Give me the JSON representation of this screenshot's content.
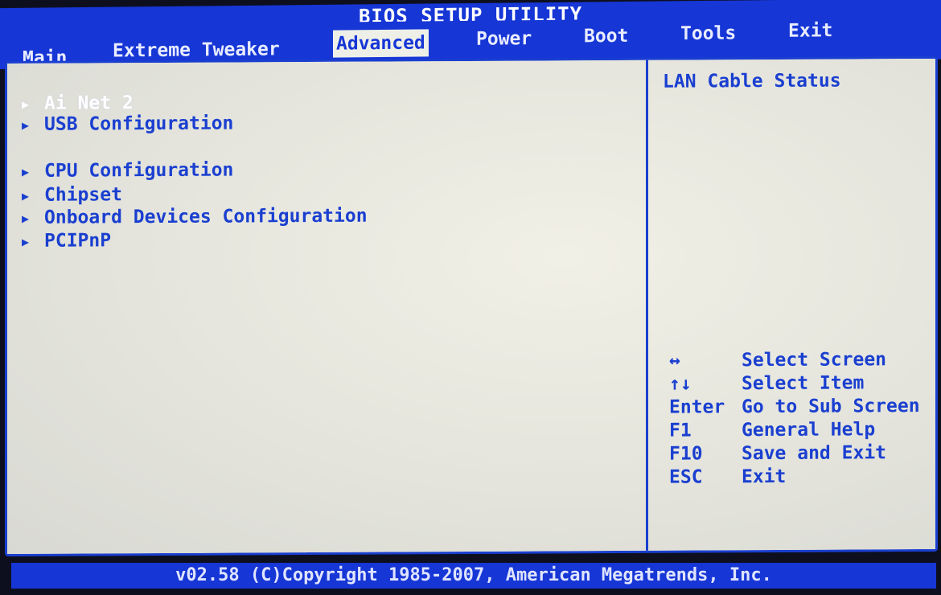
{
  "title": "BIOS SETUP UTILITY",
  "menu": [
    {
      "label": "Main",
      "active": false
    },
    {
      "label": "Extreme Tweaker",
      "active": false
    },
    {
      "label": "Advanced",
      "active": true
    },
    {
      "label": "Power",
      "active": false
    },
    {
      "label": "Boot",
      "active": false
    },
    {
      "label": "Tools",
      "active": false
    },
    {
      "label": "Exit",
      "active": false
    }
  ],
  "entries": [
    {
      "label": "Ai Net 2",
      "selected": true
    },
    {
      "label": "USB Configuration",
      "selected": false
    },
    {
      "label": "CPU Configuration",
      "selected": false
    },
    {
      "label": "Chipset",
      "selected": false
    },
    {
      "label": "Onboard Devices Configuration",
      "selected": false
    },
    {
      "label": "PCIPnP",
      "selected": false
    }
  ],
  "arrow_icon": "▶",
  "help": {
    "title": "LAN Cable Status"
  },
  "keys": [
    {
      "key": "↔",
      "action": "Select Screen"
    },
    {
      "key": "↑↓",
      "action": "Select Item"
    },
    {
      "key": "Enter",
      "action": "Go to Sub Screen"
    },
    {
      "key": "F1",
      "action": "General Help"
    },
    {
      "key": "F10",
      "action": "Save and Exit"
    },
    {
      "key": "ESC",
      "action": "Exit"
    }
  ],
  "footer": "v02.58 (C)Copyright 1985-2007, American Megatrends, Inc.",
  "colors": {
    "bar_blue": "#1636d6",
    "text_blue": "#1a3fd0",
    "panel_bg": "#e6e6df",
    "selected_text": "#ffffff"
  }
}
